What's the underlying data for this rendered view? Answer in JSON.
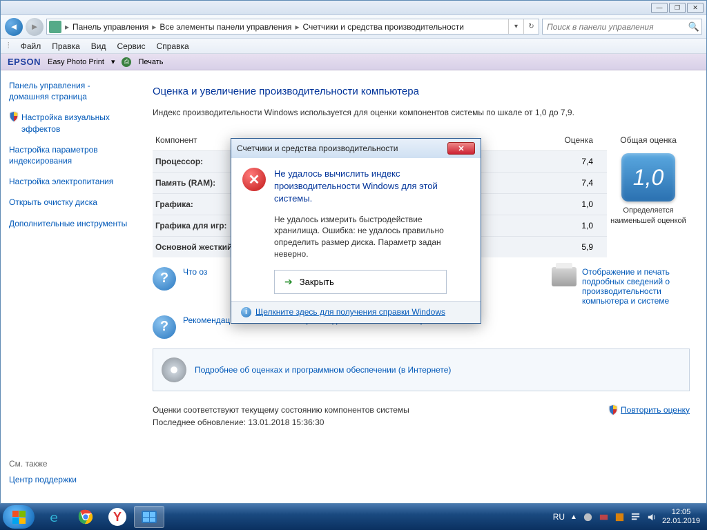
{
  "titlebar": {
    "min": "—",
    "max": "❐",
    "close": "✕"
  },
  "nav": {
    "crumbs": [
      "Панель управления",
      "Все элементы панели управления",
      "Счетчики и средства производительности"
    ],
    "search_placeholder": "Поиск в панели управления"
  },
  "menu": {
    "grip": "⦙",
    "file": "Файл",
    "edit": "Правка",
    "view": "Вид",
    "service": "Сервис",
    "help": "Справка"
  },
  "epson": {
    "logo": "EPSON",
    "app": "Easy Photo Print",
    "dd": "▾",
    "print": "Печать"
  },
  "sidebar": {
    "home": "Панель управления - домашняя страница",
    "l1": "Настройка визуальных эффектов",
    "l2": "Настройка параметров индексирования",
    "l3": "Настройка электропитания",
    "l4": "Открыть очистку диска",
    "l5": "Дополнительные инструменты",
    "see_also": "См. также",
    "support": "Центр поддержки"
  },
  "main": {
    "heading": "Оценка и увеличение производительности компьютера",
    "desc": "Индекс производительности Windows используется для оценки компонентов системы по шкале от 1,0 до 7,9.",
    "col_component": "Компонент",
    "col_score": "Оценка",
    "col_overall": "Общая оценка",
    "rows": [
      {
        "name": "Процессор:",
        "score": "7,4"
      },
      {
        "name": "Память (RAM):",
        "score": "7,4"
      },
      {
        "name": "Графика:",
        "score": "1,0"
      },
      {
        "name": "Графика для игр:",
        "score": "1,0"
      },
      {
        "name": "Основной жесткий диск:",
        "score": "5,9"
      }
    ],
    "overall_value": "1,0",
    "overall_label": "Определяется наименьшей оценкой",
    "link_what": "Что оз",
    "link_reco": "Рекомендации по повышению производительности компьютера.",
    "link_print": "Отображение и печать подробных сведений о производительности компьютера и системе",
    "link_more": "Подробнее об оценках и программном обеспечении (в Интернете)",
    "footnote1": "Оценки соответствуют текущему состоянию компонентов системы",
    "footnote2": "Последнее обновление: 13.01.2018 15:36:30",
    "repeat": "Повторить оценку"
  },
  "dialog": {
    "title": "Счетчики и средства производительности",
    "heading": "Не удалось вычислить индекс производительности Windows для этой системы.",
    "body": "Не удалось измерить быстродействие хранилища. Ошибка: не удалось правильно определить размер диска. Параметр задан неверно.",
    "close_btn": "Закрыть",
    "help_link": "Щелкните здесь для получения справки Windows"
  },
  "taskbar": {
    "lang": "RU",
    "time": "12:05",
    "date": "22.01.2019"
  }
}
